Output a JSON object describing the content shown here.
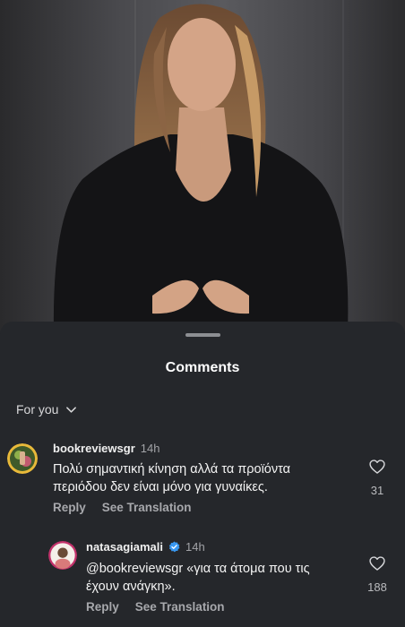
{
  "sheet": {
    "title": "Comments",
    "filter_label": "For you"
  },
  "comments": [
    {
      "username": "bookreviewsgr",
      "time": "14h",
      "text_line1": "Πολύ σημαντική κίνηση αλλά τα προϊόντα",
      "text_line2": "περιόδου δεν είναι μόνο για γυναίκες.",
      "reply_label": "Reply",
      "translate_label": "See Translation",
      "like_count": "31",
      "verified": false
    },
    {
      "username": "natasagiamali",
      "time": "14h",
      "text_line1": "@bookreviewsgr «για τα άτομα που τις",
      "text_line2": "έχουν ανάγκη».",
      "reply_label": "Reply",
      "translate_label": "See Translation",
      "like_count": "188",
      "verified": true
    }
  ],
  "colors": {
    "sheet_bg": "#25272b",
    "verified_blue": "#3897f0",
    "muted_text": "#a7a8ac"
  },
  "icons": {
    "filter": "chevron-down-icon",
    "like": "heart-icon",
    "verified": "verified-badge-icon"
  }
}
